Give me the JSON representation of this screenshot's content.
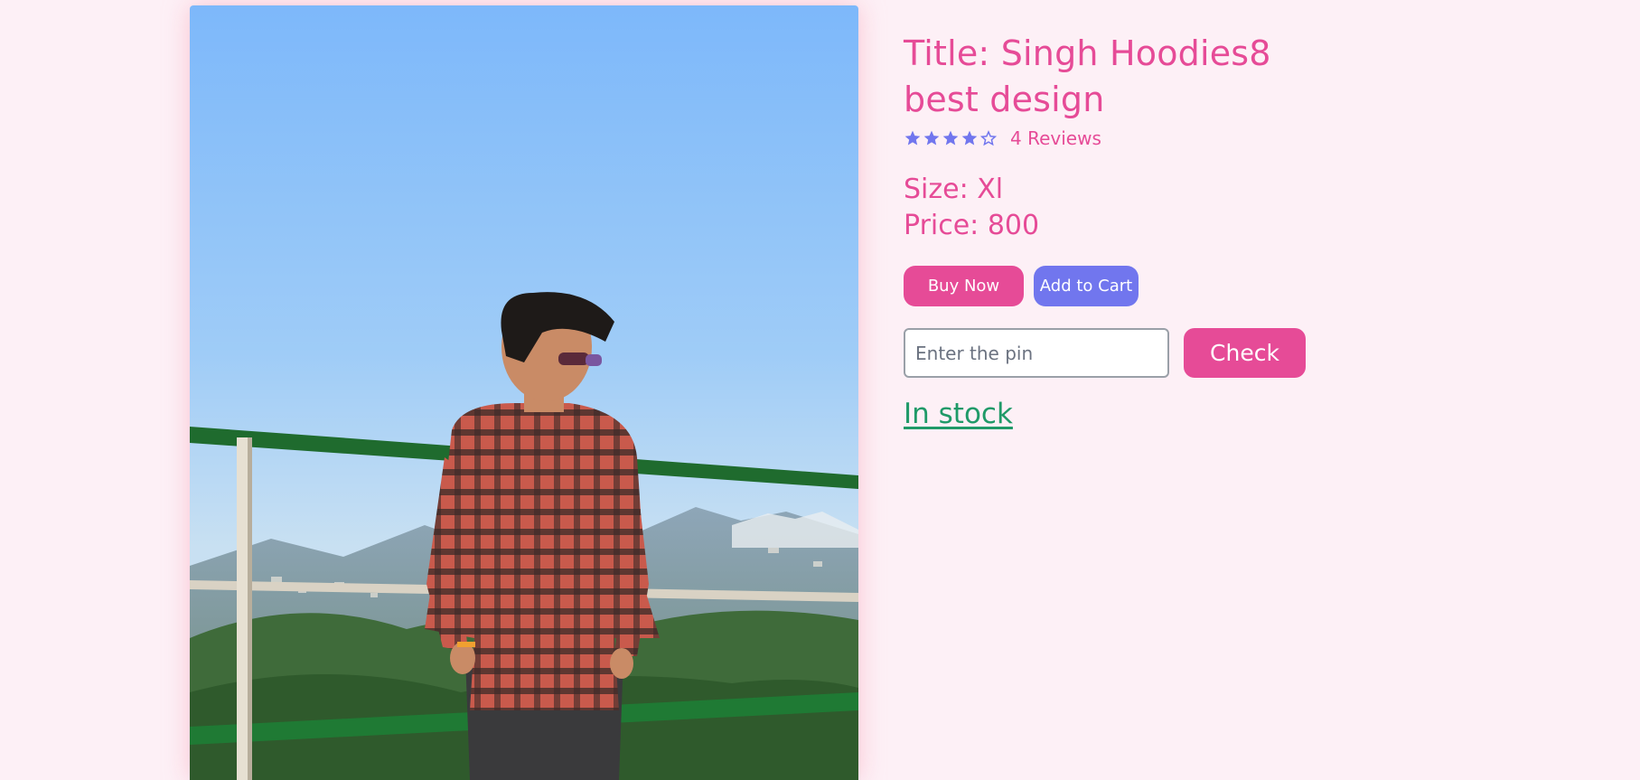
{
  "product": {
    "title": "Title: Singh Hoodies8 best design",
    "rating": {
      "value": 4,
      "max": 5
    },
    "reviews_label": "4 Reviews",
    "size_label": "Size: Xl",
    "price_label": "Price: 800"
  },
  "actions": {
    "buy_label": "Buy Now",
    "cart_label": "Add to Cart"
  },
  "pin": {
    "placeholder": "Enter the pin",
    "value": "",
    "check_label": "Check"
  },
  "availability": {
    "label": "In stock"
  },
  "colors": {
    "page_background": "#fdf0f6",
    "brand_pink": "#e64b97",
    "accent_indigo": "#7176ee",
    "stock_green": "#1f9a68"
  },
  "icons": {
    "star_filled": "star-filled-icon",
    "star_empty": "star-empty-icon"
  }
}
